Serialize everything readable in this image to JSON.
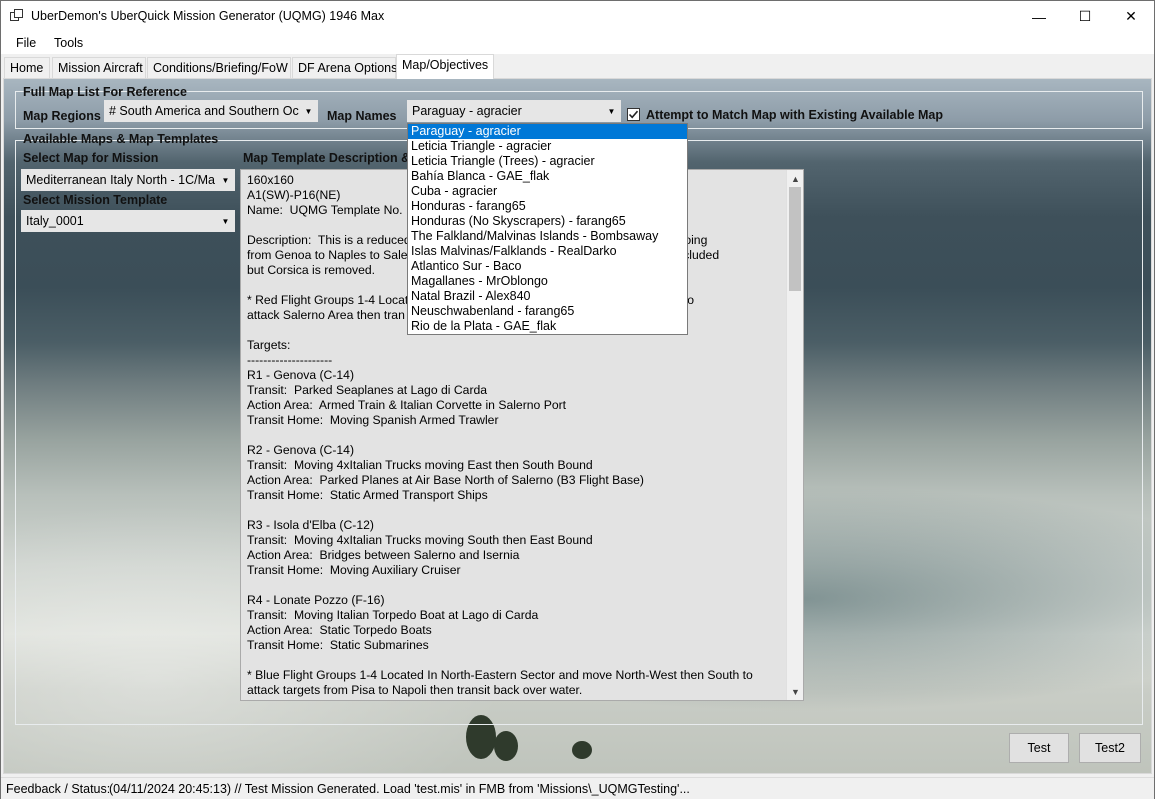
{
  "window": {
    "title": "UberDemon's UberQuick Mission Generator (UQMG) 1946 Max",
    "minimize": "—",
    "maximize": "☐",
    "close": "✕"
  },
  "menu": {
    "file": "File",
    "tools": "Tools"
  },
  "tabs": [
    {
      "label": "Home"
    },
    {
      "label": "Mission Aircraft"
    },
    {
      "label": "Conditions/Briefing/FoW"
    },
    {
      "label": "DF Arena Options"
    },
    {
      "label": "Map/Objectives",
      "active": true
    }
  ],
  "full_map_list": {
    "title": "Full Map List For Reference",
    "regions_label": "Map Regions",
    "regions_value": "# South America and Southern Oc",
    "names_label": "Map Names",
    "names_value": "Paraguay - agracier",
    "match_checkbox_label": "Attempt to Match Map with Existing Available Map",
    "match_checked": true,
    "dropdown_items": [
      "Paraguay - agracier",
      "Leticia Triangle - agracier",
      "Leticia Triangle (Trees) - agracier",
      "Bahía Blanca - GAE_flak",
      "Cuba - agracier",
      "Honduras - farang65",
      "Honduras (No Skyscrapers) - farang65",
      "The Falkland/Malvinas Islands - Bombsaway",
      "Islas Malvinas/Falklands - RealDarko",
      "Atlantico Sur - Baco",
      "Magallanes - MrOblongo",
      "Natal Brazil - Alex840",
      "Neuschwabenland - farang65",
      "Rio de la Plata - GAE_flak"
    ]
  },
  "available_maps": {
    "title": "Available Maps & Map Templates",
    "select_map_label": "Select Map for Mission",
    "select_map_value": "Mediterranean Italy North - 1C/Ma",
    "select_template_label": "Select Mission Template",
    "select_template_value": "Italy_0001",
    "description_label": "Map Template Description & I",
    "description_lines": [
      "160x160",
      "A1(SW)-P16(NE)",
      "Name:  UQMG Template No.",
      "",
      "Description:  This is a reduced                                                                   le map going",
      "from Genoa to Naples to Sale                                                                      nd is included",
      "but Corsica is removed.",
      "",
      "* Red Flight Groups 1-4 Locat                                                                    n South to",
      "attack Salerno Area then tran",
      "",
      "Targets:",
      "---------------------",
      "R1 - Genova (C-14)",
      "Transit:  Parked Seaplanes at Lago di Carda",
      "Action Area:  Armed Train & Italian Corvette in Salerno Port",
      "Transit Home:  Moving Spanish Armed Trawler",
      "",
      "R2 - Genova (C-14)",
      "Transit:  Moving 4xItalian Trucks moving East then South Bound",
      "Action Area:  Parked Planes at Air Base North of Salerno (B3 Flight Base)",
      "Transit Home:  Static Armed Transport Ships",
      "",
      "R3 - Isola d'Elba (C-12)",
      "Transit:  Moving 4xItalian Trucks moving South then East Bound",
      "Action Area:  Bridges between Salerno and Isernia",
      "Transit Home:  Moving Auxiliary Cruiser",
      "",
      "R4 - Lonate Pozzo (F-16)",
      "Transit:  Moving Italian Torpedo Boat at Lago di Carda",
      "Action Area:  Static Torpedo Boats",
      "Transit Home:  Static Submarines",
      "",
      "* Blue Flight Groups 1-4 Located In North-Eastern Sector and move North-West then South to",
      "attack targets from Pisa to Napoli then transit back over water."
    ]
  },
  "buttons": {
    "test": "Test",
    "test2": "Test2"
  },
  "status": {
    "label": "Feedback / Status:",
    "text": "(04/11/2024 20:45:13) // Test Mission Generated.  Load 'test.mis' in FMB from 'Missions\\_UQMGTesting'..."
  }
}
